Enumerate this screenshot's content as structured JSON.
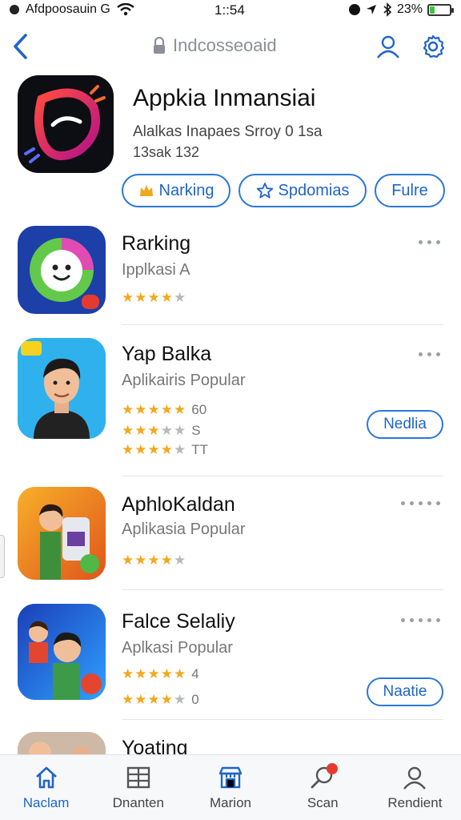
{
  "status_bar": {
    "carrier": "Afdpoosauin G",
    "time": "1::54",
    "battery_text": "23%",
    "battery_level": 0.23
  },
  "nav": {
    "title": "Indcosseoaid"
  },
  "featured": {
    "title": "Appkia Inmansiai",
    "subtitle": "Alalkas Inapaes Srroy 0 1sa",
    "meta": "13sak 132",
    "chips": [
      {
        "label": "Narking",
        "icon": "crown-icon"
      },
      {
        "label": "Spdomias",
        "icon": "star-icon"
      },
      {
        "label": "Fulre"
      }
    ]
  },
  "apps": [
    {
      "name": "Rarking",
      "category": "Ipplkasi A",
      "ratings": [
        {
          "stars": 4,
          "text": ""
        }
      ]
    },
    {
      "name": "Yap Balka",
      "category": "Aplikairis Popular",
      "ratings": [
        {
          "stars": 5,
          "text": "60"
        },
        {
          "stars": 3,
          "text": "S"
        },
        {
          "stars": 4,
          "text": "TT"
        }
      ],
      "action": "Nedlia"
    },
    {
      "name": "AphloKaldan",
      "category": "Aplikasia Popular",
      "ratings": [
        {
          "stars": 4,
          "text": ""
        }
      ]
    },
    {
      "name": "Falce Selaliy",
      "category": "Aplkasi Popular",
      "ratings": [
        {
          "stars": 5,
          "text": "4"
        },
        {
          "stars": 4,
          "text": "0"
        }
      ],
      "action": "Naatie"
    },
    {
      "name": "Yoating"
    }
  ],
  "tabs": [
    {
      "label": "Naclam",
      "icon": "home-icon",
      "active": true
    },
    {
      "label": "Dnanten",
      "icon": "grid-icon"
    },
    {
      "label": "Marion",
      "icon": "store-icon"
    },
    {
      "label": "Scan",
      "icon": "search-icon",
      "badge": true
    },
    {
      "label": "Rendient",
      "icon": "profile-icon"
    }
  ],
  "colors": {
    "accent": "#1f64c8",
    "star": "#f2a81d",
    "badge": "#e53a2f"
  }
}
